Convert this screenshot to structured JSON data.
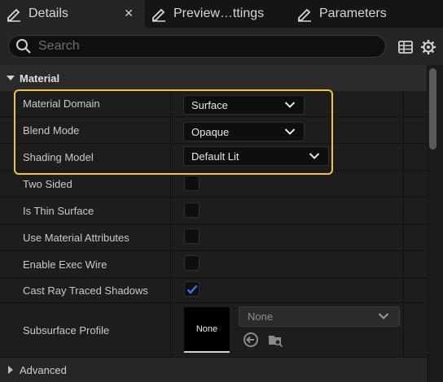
{
  "tabs": [
    {
      "label": "Details",
      "icon": "pencil-icon",
      "active": true,
      "close": "✕"
    },
    {
      "label": "Preview…ttings",
      "icon": "pencil-icon",
      "active": false
    },
    {
      "label": "Parameters",
      "icon": "pencil-icon",
      "active": false
    }
  ],
  "search": {
    "placeholder": "Search",
    "value": ""
  },
  "toolbar": {
    "table_icon": "table-view-icon",
    "settings_icon": "gear-icon"
  },
  "category": {
    "label": "Material"
  },
  "properties": {
    "material_domain": {
      "label": "Material Domain",
      "value": "Surface"
    },
    "blend_mode": {
      "label": "Blend Mode",
      "value": "Opaque"
    },
    "shading_model": {
      "label": "Shading Model",
      "value": "Default Lit"
    },
    "two_sided": {
      "label": "Two Sided",
      "checked": false
    },
    "is_thin_surface": {
      "label": "Is Thin Surface",
      "checked": false
    },
    "use_material_attributes": {
      "label": "Use Material Attributes",
      "checked": false
    },
    "enable_exec_wire": {
      "label": "Enable Exec Wire",
      "checked": false
    },
    "cast_ray_traced_shadows": {
      "label": "Cast Ray Traced Shadows",
      "checked": true
    },
    "subsurface_profile": {
      "label": "Subsurface Profile",
      "thumbnail": "None",
      "asset": "None"
    }
  },
  "advanced": {
    "label": "Advanced"
  },
  "colors": {
    "accent_check": "#2f7cf6",
    "highlight": "#f2c43a"
  }
}
